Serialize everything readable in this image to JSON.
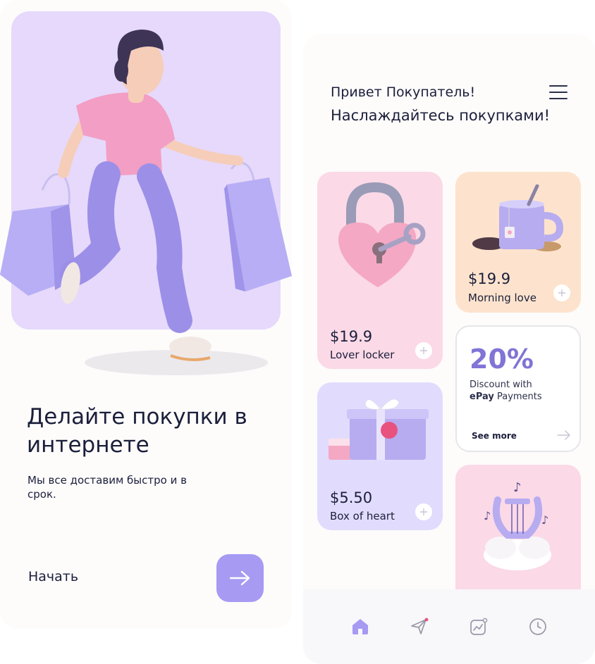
{
  "onboarding": {
    "title": "Делайте покупки в интернете",
    "subtitle": "Мы все доставим быстро и в срок.",
    "start_label": "Начать",
    "accent": "#a79af3"
  },
  "shop": {
    "greeting": "Привет Покупатель!",
    "greeting_sub": "Наслаждайтесь покупками!",
    "products": [
      {
        "price": "$19.9",
        "name": "Lover locker",
        "color": "#fbd9e7"
      },
      {
        "price": "$19.9",
        "name": "Morning love",
        "color": "#fde3cd"
      },
      {
        "price": "$5.50",
        "name": "Box of heart",
        "color": "#e1dcfd"
      }
    ],
    "discount": {
      "percent": "20%",
      "line1": "Discount with",
      "brand": "ePay",
      "line2_rest": " Payments",
      "link": "See more"
    },
    "nav": [
      {
        "icon": "home-icon",
        "active": true
      },
      {
        "icon": "send-icon",
        "active": false
      },
      {
        "icon": "chart-icon",
        "active": false
      },
      {
        "icon": "clock-icon",
        "active": false
      }
    ]
  }
}
